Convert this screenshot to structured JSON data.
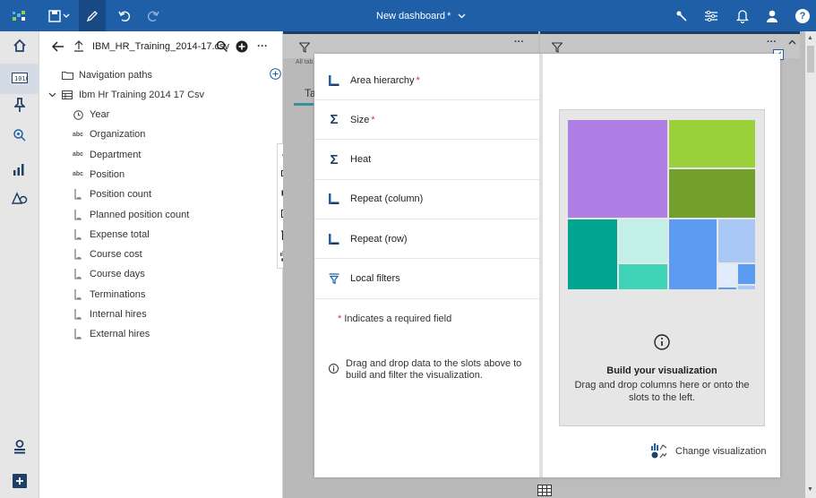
{
  "topbar": {
    "title": "New dashboard",
    "title_mark": "*",
    "help_glyph": "?"
  },
  "data_panel": {
    "source_name": "IBM_HR_Training_2014-17.csv",
    "more_glyph": "···",
    "nav_paths_label": "Navigation paths",
    "table_label": "Ibm Hr Training 2014 17 Csv",
    "fields": [
      {
        "label": "Year",
        "icon": "clock-icon"
      },
      {
        "label": "Organization",
        "icon": "text-abc-icon"
      },
      {
        "label": "Department",
        "icon": "text-abc-icon"
      },
      {
        "label": "Position",
        "icon": "text-abc-icon"
      },
      {
        "label": "Position count",
        "icon": "measure-icon"
      },
      {
        "label": "Planned position count",
        "icon": "measure-icon"
      },
      {
        "label": "Expense total",
        "icon": "measure-icon"
      },
      {
        "label": "Course cost",
        "icon": "measure-icon"
      },
      {
        "label": "Course days",
        "icon": "measure-icon"
      },
      {
        "label": "Terminations",
        "icon": "measure-icon"
      },
      {
        "label": "Internal hires",
        "icon": "measure-icon"
      },
      {
        "label": "External hires",
        "icon": "measure-icon"
      }
    ],
    "abc_text": "abc"
  },
  "canvas": {
    "all_tabs_label": "All tab",
    "tab_fragment": "Ta",
    "more_glyph": "···"
  },
  "slots": [
    {
      "label": "Area hierarchy",
      "required": "*",
      "icon": "dimension-icon"
    },
    {
      "label": "Size",
      "required": "*",
      "icon": "sigma-icon"
    },
    {
      "label": "Heat",
      "required": "",
      "icon": "sigma-icon"
    },
    {
      "label": "Repeat (column)",
      "required": "",
      "icon": "dimension-icon"
    },
    {
      "label": "Repeat (row)",
      "required": "",
      "icon": "dimension-icon"
    },
    {
      "label": "Local filters",
      "required": "",
      "icon": "filter-icon"
    }
  ],
  "sigma_glyph": "Σ",
  "required_note": {
    "mark": "*",
    "text": " Indicates a required field"
  },
  "help_text": "Drag and drop data to the slots above to build and filter the visualization.",
  "preview": {
    "title": "Build your visualization",
    "body": "Drag and drop columns here or onto the slots to the left."
  },
  "change_viz_label": "Change visualization",
  "colors": {
    "topbar": "#1f5fa8",
    "treemap": [
      "#b07fe6",
      "#9ad03a",
      "#739f2c",
      "#00a68f",
      "#c2f0e6",
      "#3fd3b8",
      "#5b9bf2",
      "#a9c8f6",
      "#e0ebfb"
    ]
  }
}
